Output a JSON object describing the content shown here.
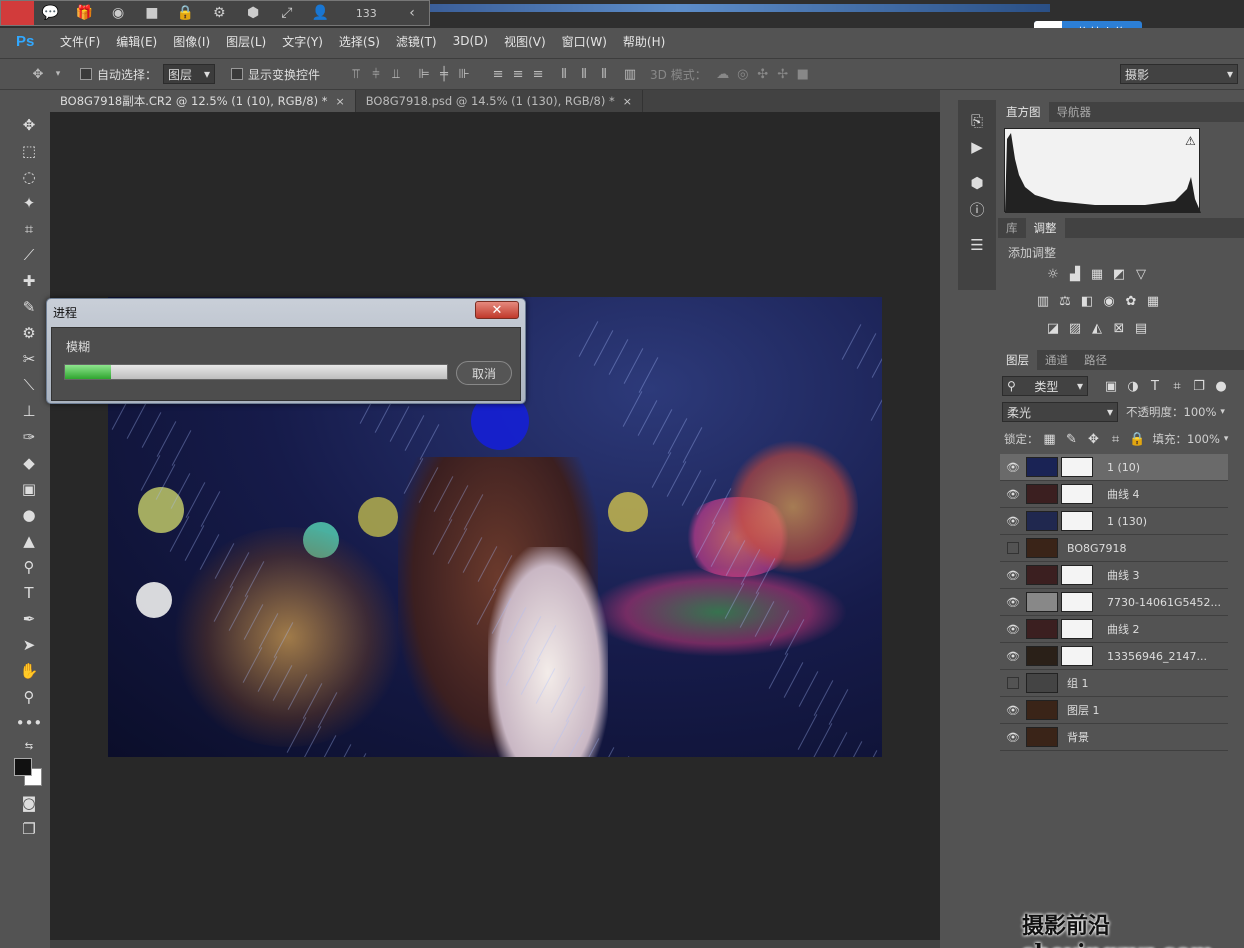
{
  "ext_toolbar": {
    "count": "133",
    "icons": [
      "close-red",
      "chat-icon",
      "gift-icon",
      "record-icon",
      "camera-icon",
      "lock-icon",
      "gear-icon",
      "cube-icon",
      "fullscreen-icon",
      "user-icon",
      "chevron-left-icon"
    ]
  },
  "upload": {
    "label": "拖拽上传"
  },
  "menu": {
    "logo": "Ps",
    "items": [
      "文件(F)",
      "编辑(E)",
      "图像(I)",
      "图层(L)",
      "文字(Y)",
      "选择(S)",
      "滤镜(T)",
      "3D(D)",
      "视图(V)",
      "窗口(W)",
      "帮助(H)"
    ]
  },
  "options": {
    "auto_select": "自动选择：",
    "auto_select_value": "图层",
    "show_transform": "显示变换控件",
    "mode_3d": "3D 模式：",
    "workspace": "摄影"
  },
  "tabs": [
    {
      "label": "BO8G7918副本.CR2 @ 12.5% (1 (10), RGB/8) *",
      "close": "×"
    },
    {
      "label": "BO8G7918.psd @ 14.5% (1 (130), RGB/8) *",
      "close": "×"
    }
  ],
  "panels": {
    "histogram_tabs": [
      "直方图",
      "导航器"
    ],
    "adj_tabs": [
      "库",
      "调整"
    ],
    "adj_title": "添加调整",
    "layer_tabs": [
      "图层",
      "通道",
      "路径"
    ],
    "filter_kind": "类型",
    "blend_mode": "柔光",
    "opacity_label": "不透明度：",
    "opacity_value": "100%",
    "lock_label": "锁定：",
    "fill_label": "填充：",
    "fill_value": "100%"
  },
  "layers": [
    {
      "name": "1 (10)",
      "visible": true,
      "selected": true
    },
    {
      "name": "曲线 4",
      "visible": true
    },
    {
      "name": "1 (130)",
      "visible": true
    },
    {
      "name": "BO8G7918",
      "visible": false
    },
    {
      "name": "曲线 3",
      "visible": true
    },
    {
      "name": "7730-14061G5452...",
      "visible": true
    },
    {
      "name": "曲线 2",
      "visible": true
    },
    {
      "name": "13356946_2147...",
      "visible": true
    },
    {
      "name": "组 1",
      "visible": false
    },
    {
      "name": "图层 1",
      "visible": true
    },
    {
      "name": "背景",
      "visible": true
    }
  ],
  "dialog": {
    "title": "进程",
    "message": "模糊",
    "cancel": "取消",
    "progress": 0.12
  },
  "watermark": "摄影前沿 sheyingzyz.com",
  "colors": {
    "ps_blue": "#31a8ff",
    "panel": "#535353",
    "canvas": "#282828",
    "upload_blue": "#2c7fd6"
  }
}
